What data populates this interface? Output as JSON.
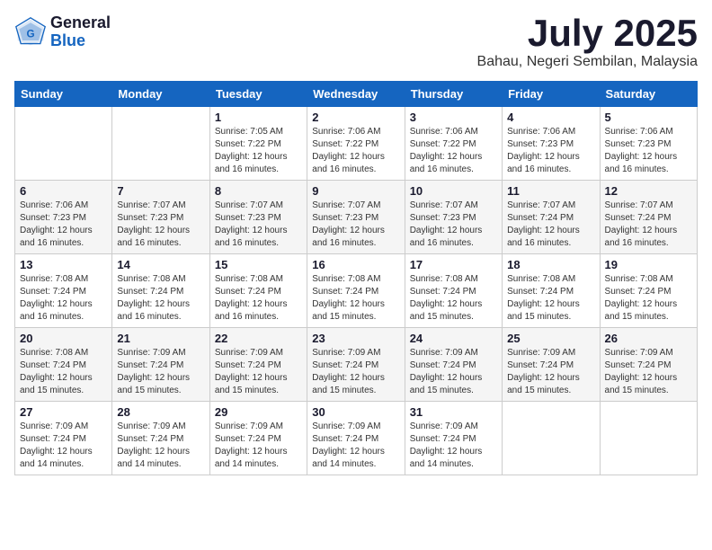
{
  "logo": {
    "general": "General",
    "blue": "Blue"
  },
  "title": {
    "month": "July 2025",
    "location": "Bahau, Negeri Sembilan, Malaysia"
  },
  "weekdays": [
    "Sunday",
    "Monday",
    "Tuesday",
    "Wednesday",
    "Thursday",
    "Friday",
    "Saturday"
  ],
  "weeks": [
    [
      {
        "day": "",
        "sunrise": "",
        "sunset": "",
        "daylight": ""
      },
      {
        "day": "",
        "sunrise": "",
        "sunset": "",
        "daylight": ""
      },
      {
        "day": "1",
        "sunrise": "Sunrise: 7:05 AM",
        "sunset": "Sunset: 7:22 PM",
        "daylight": "Daylight: 12 hours and 16 minutes."
      },
      {
        "day": "2",
        "sunrise": "Sunrise: 7:06 AM",
        "sunset": "Sunset: 7:22 PM",
        "daylight": "Daylight: 12 hours and 16 minutes."
      },
      {
        "day": "3",
        "sunrise": "Sunrise: 7:06 AM",
        "sunset": "Sunset: 7:22 PM",
        "daylight": "Daylight: 12 hours and 16 minutes."
      },
      {
        "day": "4",
        "sunrise": "Sunrise: 7:06 AM",
        "sunset": "Sunset: 7:23 PM",
        "daylight": "Daylight: 12 hours and 16 minutes."
      },
      {
        "day": "5",
        "sunrise": "Sunrise: 7:06 AM",
        "sunset": "Sunset: 7:23 PM",
        "daylight": "Daylight: 12 hours and 16 minutes."
      }
    ],
    [
      {
        "day": "6",
        "sunrise": "Sunrise: 7:06 AM",
        "sunset": "Sunset: 7:23 PM",
        "daylight": "Daylight: 12 hours and 16 minutes."
      },
      {
        "day": "7",
        "sunrise": "Sunrise: 7:07 AM",
        "sunset": "Sunset: 7:23 PM",
        "daylight": "Daylight: 12 hours and 16 minutes."
      },
      {
        "day": "8",
        "sunrise": "Sunrise: 7:07 AM",
        "sunset": "Sunset: 7:23 PM",
        "daylight": "Daylight: 12 hours and 16 minutes."
      },
      {
        "day": "9",
        "sunrise": "Sunrise: 7:07 AM",
        "sunset": "Sunset: 7:23 PM",
        "daylight": "Daylight: 12 hours and 16 minutes."
      },
      {
        "day": "10",
        "sunrise": "Sunrise: 7:07 AM",
        "sunset": "Sunset: 7:23 PM",
        "daylight": "Daylight: 12 hours and 16 minutes."
      },
      {
        "day": "11",
        "sunrise": "Sunrise: 7:07 AM",
        "sunset": "Sunset: 7:24 PM",
        "daylight": "Daylight: 12 hours and 16 minutes."
      },
      {
        "day": "12",
        "sunrise": "Sunrise: 7:07 AM",
        "sunset": "Sunset: 7:24 PM",
        "daylight": "Daylight: 12 hours and 16 minutes."
      }
    ],
    [
      {
        "day": "13",
        "sunrise": "Sunrise: 7:08 AM",
        "sunset": "Sunset: 7:24 PM",
        "daylight": "Daylight: 12 hours and 16 minutes."
      },
      {
        "day": "14",
        "sunrise": "Sunrise: 7:08 AM",
        "sunset": "Sunset: 7:24 PM",
        "daylight": "Daylight: 12 hours and 16 minutes."
      },
      {
        "day": "15",
        "sunrise": "Sunrise: 7:08 AM",
        "sunset": "Sunset: 7:24 PM",
        "daylight": "Daylight: 12 hours and 16 minutes."
      },
      {
        "day": "16",
        "sunrise": "Sunrise: 7:08 AM",
        "sunset": "Sunset: 7:24 PM",
        "daylight": "Daylight: 12 hours and 15 minutes."
      },
      {
        "day": "17",
        "sunrise": "Sunrise: 7:08 AM",
        "sunset": "Sunset: 7:24 PM",
        "daylight": "Daylight: 12 hours and 15 minutes."
      },
      {
        "day": "18",
        "sunrise": "Sunrise: 7:08 AM",
        "sunset": "Sunset: 7:24 PM",
        "daylight": "Daylight: 12 hours and 15 minutes."
      },
      {
        "day": "19",
        "sunrise": "Sunrise: 7:08 AM",
        "sunset": "Sunset: 7:24 PM",
        "daylight": "Daylight: 12 hours and 15 minutes."
      }
    ],
    [
      {
        "day": "20",
        "sunrise": "Sunrise: 7:08 AM",
        "sunset": "Sunset: 7:24 PM",
        "daylight": "Daylight: 12 hours and 15 minutes."
      },
      {
        "day": "21",
        "sunrise": "Sunrise: 7:09 AM",
        "sunset": "Sunset: 7:24 PM",
        "daylight": "Daylight: 12 hours and 15 minutes."
      },
      {
        "day": "22",
        "sunrise": "Sunrise: 7:09 AM",
        "sunset": "Sunset: 7:24 PM",
        "daylight": "Daylight: 12 hours and 15 minutes."
      },
      {
        "day": "23",
        "sunrise": "Sunrise: 7:09 AM",
        "sunset": "Sunset: 7:24 PM",
        "daylight": "Daylight: 12 hours and 15 minutes."
      },
      {
        "day": "24",
        "sunrise": "Sunrise: 7:09 AM",
        "sunset": "Sunset: 7:24 PM",
        "daylight": "Daylight: 12 hours and 15 minutes."
      },
      {
        "day": "25",
        "sunrise": "Sunrise: 7:09 AM",
        "sunset": "Sunset: 7:24 PM",
        "daylight": "Daylight: 12 hours and 15 minutes."
      },
      {
        "day": "26",
        "sunrise": "Sunrise: 7:09 AM",
        "sunset": "Sunset: 7:24 PM",
        "daylight": "Daylight: 12 hours and 15 minutes."
      }
    ],
    [
      {
        "day": "27",
        "sunrise": "Sunrise: 7:09 AM",
        "sunset": "Sunset: 7:24 PM",
        "daylight": "Daylight: 12 hours and 14 minutes."
      },
      {
        "day": "28",
        "sunrise": "Sunrise: 7:09 AM",
        "sunset": "Sunset: 7:24 PM",
        "daylight": "Daylight: 12 hours and 14 minutes."
      },
      {
        "day": "29",
        "sunrise": "Sunrise: 7:09 AM",
        "sunset": "Sunset: 7:24 PM",
        "daylight": "Daylight: 12 hours and 14 minutes."
      },
      {
        "day": "30",
        "sunrise": "Sunrise: 7:09 AM",
        "sunset": "Sunset: 7:24 PM",
        "daylight": "Daylight: 12 hours and 14 minutes."
      },
      {
        "day": "31",
        "sunrise": "Sunrise: 7:09 AM",
        "sunset": "Sunset: 7:24 PM",
        "daylight": "Daylight: 12 hours and 14 minutes."
      },
      {
        "day": "",
        "sunrise": "",
        "sunset": "",
        "daylight": ""
      },
      {
        "day": "",
        "sunrise": "",
        "sunset": "",
        "daylight": ""
      }
    ]
  ]
}
